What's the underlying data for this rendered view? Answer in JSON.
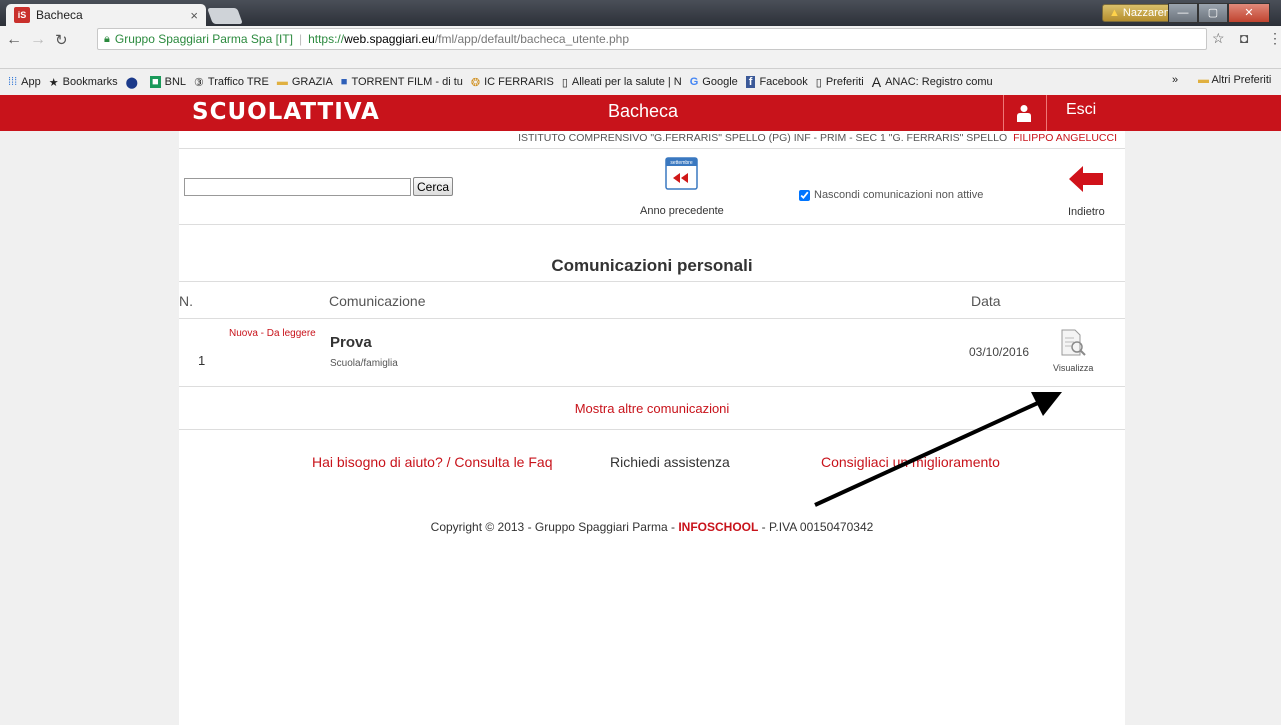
{
  "browser": {
    "tab_title": "Bacheca",
    "tab_favicon": "iS",
    "tab_close": "×",
    "user_badge": "Nazzareno",
    "url_secure_label": "Gruppo Spaggiari Parma Spa [IT]",
    "url_protocol": "https://",
    "url_host": "web.spaggiari.eu",
    "url_path": "/fml/app/default/bacheca_utente.php",
    "bookmarks": [
      {
        "label": "App",
        "icon": "apps-icon"
      },
      {
        "label": "Bookmarks",
        "icon": "star-icon"
      },
      {
        "label": "",
        "icon": "bnl-blue-icon"
      },
      {
        "label": "BNL",
        "icon": "bnl-icon"
      },
      {
        "label": "Traffico TRE",
        "icon": "tre-icon"
      },
      {
        "label": "GRAZIA",
        "icon": "folder-icon"
      },
      {
        "label": "TORRENT FILM - di tu",
        "icon": "film-icon"
      },
      {
        "label": "IC FERRARIS",
        "icon": "school-icon"
      },
      {
        "label": "Alleati per la salute | N",
        "icon": "page-icon"
      },
      {
        "label": "Google",
        "icon": "google-icon"
      },
      {
        "label": "Facebook",
        "icon": "facebook-icon"
      },
      {
        "label": "Preferiti",
        "icon": "page-icon"
      },
      {
        "label": "ANAC: Registro comu",
        "icon": "anac-icon"
      }
    ],
    "bookmarks_more": "»",
    "other_bookmarks": "Altri Preferiti"
  },
  "header": {
    "logo": "SCUOLATTIVA",
    "title": "Bacheca",
    "logout": "Esci"
  },
  "school_line": {
    "school": "ISTITUTO COMPRENSIVO \"G.FERRARIS\" SPELLO (PG) INF - PRIM - SEC 1 \"G. FERRARIS\" SPELLO",
    "user": "FILIPPO ANGELUCCI"
  },
  "toolbar": {
    "search_value": "",
    "search_button": "Cerca",
    "calendar_month": "settembre",
    "prev_year": "Anno precedente",
    "hide_inactive": "Nascondi comunicazioni non attive",
    "hide_inactive_checked": true,
    "back": "Indietro"
  },
  "communications": {
    "title": "Comunicazioni personali",
    "columns": {
      "num": "N.",
      "comm": "Comunicazione",
      "date": "Data"
    },
    "rows": [
      {
        "num": "1",
        "badge": "Nuova - Da leggere",
        "title": "Prova",
        "category": "Scuola/famiglia",
        "date": "03/10/2016",
        "action": "Visualizza"
      }
    ],
    "show_more": "Mostra altre comunicazioni"
  },
  "footer": {
    "help": "Hai bisogno di aiuto? / Consulta le Faq",
    "assist": "Richiedi assistenza",
    "suggest": "Consigliaci un miglioramento",
    "copyright_prefix": "Copyright © 2013 - Gruppo Spaggiari Parma - ",
    "copyright_brand": "INFOSCHOOL",
    "copyright_suffix": " - P.IVA 00150470342"
  },
  "colors": {
    "brand_red": "#c8131b",
    "annotation_arrow": "#000000"
  }
}
